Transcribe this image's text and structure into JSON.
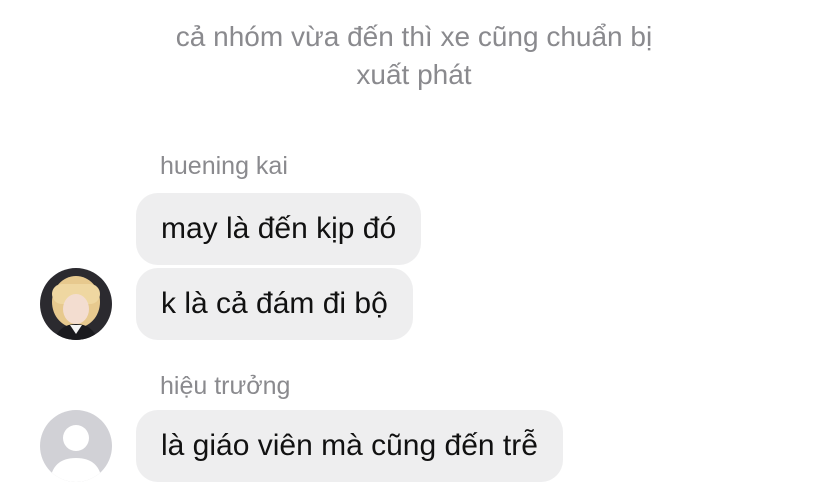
{
  "system_note": {
    "line1": "cả nhóm vừa đến thì xe cũng chuẩn bị",
    "line2": "xuất phát"
  },
  "groups": [
    {
      "sender": "huening kai",
      "avatar": "user-photo-avatar",
      "messages": [
        "may là đến kịp đó",
        "k là cả đám đi bộ"
      ]
    },
    {
      "sender": "hiệu trưởng",
      "avatar": "default-person-icon",
      "messages": [
        "là giáo viên mà cũng đến trễ"
      ]
    }
  ],
  "colors": {
    "bubble": "#eeeeef",
    "meta_text": "#8a8a8e",
    "message_text": "#111111",
    "default_avatar_bg": "#d1d1d6"
  }
}
